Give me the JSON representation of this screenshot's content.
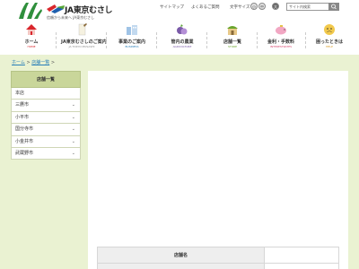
{
  "header": {
    "brand_name": "JA東京むさし",
    "tagline": "信頼から未来へ JA東京むさし",
    "sitemap_label": "サイトマップ",
    "faq_label": "よくあるご質問",
    "font_size_label": "文字サイズ",
    "font_sizes": [
      "小",
      "中",
      "大"
    ],
    "search_placeholder": "サイト内検索"
  },
  "nav": {
    "items": [
      {
        "label": "ホーム",
        "sub": "HOME"
      },
      {
        "label": "JA東京むさしのご案内",
        "sub": "JA TOKYO MUSASHI"
      },
      {
        "label": "事業のご案内",
        "sub": "BUSINESS"
      },
      {
        "label": "管内の農業",
        "sub": "AGRICULTURE"
      },
      {
        "label": "店舗一覧",
        "sub": "STORE"
      },
      {
        "label": "金利・手数料",
        "sub": "INTERESTRATES"
      },
      {
        "label": "困ったときは",
        "sub": "HELP"
      }
    ]
  },
  "breadcrumb": {
    "home": "ホーム",
    "sep": " > ",
    "current": "店舗一覧",
    "tail": " >"
  },
  "sidebar": {
    "title": "店舗一覧",
    "items": [
      {
        "label": "本店"
      },
      {
        "label": "三鷹市"
      },
      {
        "label": "小平市"
      },
      {
        "label": "国分寺市"
      },
      {
        "label": "小金井市"
      },
      {
        "label": "武蔵野市"
      }
    ]
  },
  "table": {
    "row1_header": "店舗名"
  },
  "colors": {
    "accent_green": "#6aa52d",
    "band_green": "#eaf2d2",
    "sidebar_head": "#c9d69a",
    "link_blue": "#2a7fb8"
  }
}
